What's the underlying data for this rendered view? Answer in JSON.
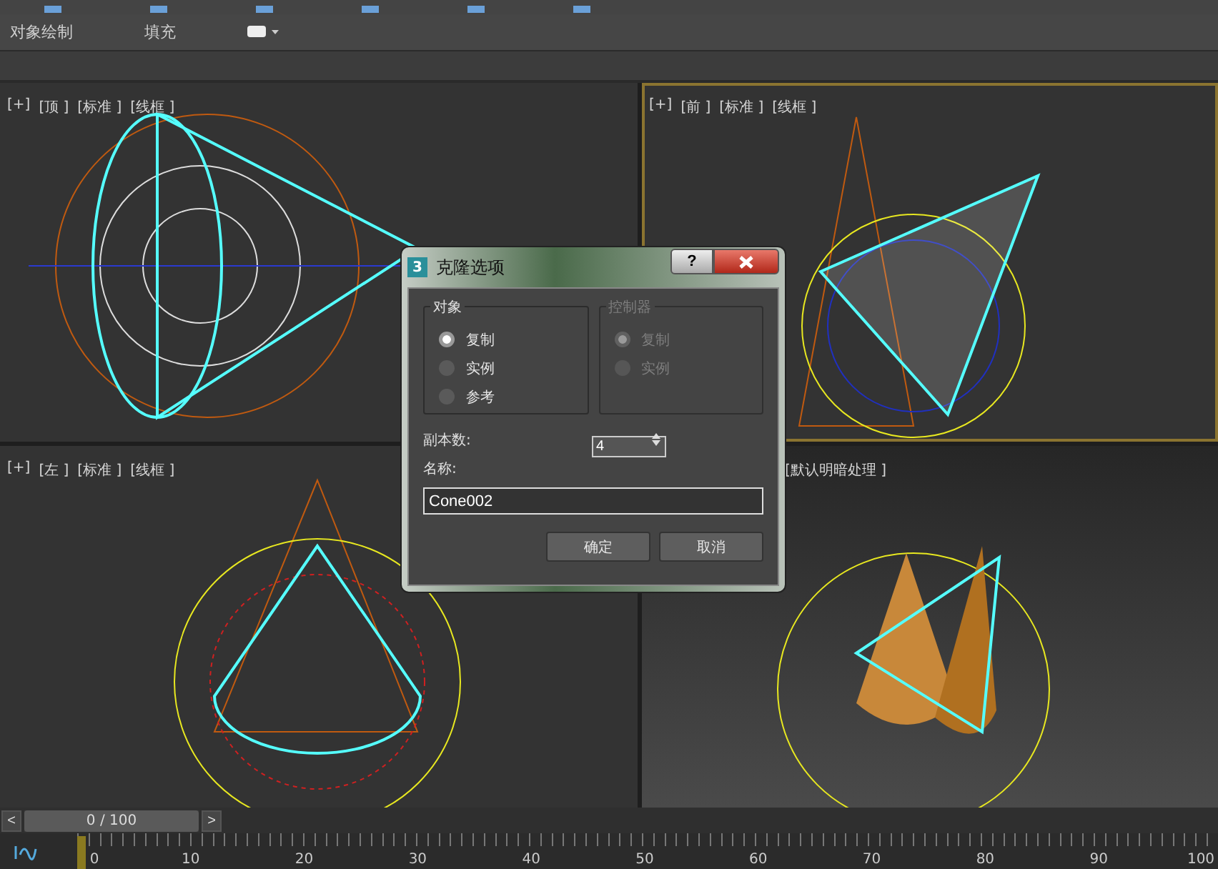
{
  "ribbon": {
    "items": [
      {
        "label": "对象绘制"
      },
      {
        "label": "填充"
      }
    ]
  },
  "viewports": [
    {
      "kind": "top",
      "selected": false,
      "labels": [
        "[+]",
        "[顶 ]",
        "[标准 ]",
        "[线框 ]"
      ]
    },
    {
      "kind": "front",
      "selected": true,
      "labels": [
        "[+]",
        "[前 ]",
        "[标准 ]",
        "[线框 ]"
      ]
    },
    {
      "kind": "left",
      "selected": false,
      "labels": [
        "[+]",
        "[左 ]",
        "[标准 ]",
        "[线框 ]"
      ]
    },
    {
      "kind": "perspective",
      "selected": false,
      "labels": [
        "[默认明暗处理 ]"
      ]
    }
  ],
  "dialog": {
    "icon_text": "3",
    "title": "克隆选项",
    "help": "?",
    "groups": [
      {
        "title": "对象",
        "enabled": true,
        "options": [
          {
            "label": "复制",
            "selected": true
          },
          {
            "label": "实例",
            "selected": false
          },
          {
            "label": "参考",
            "selected": false
          }
        ]
      },
      {
        "title": "控制器",
        "enabled": false,
        "options": [
          {
            "label": "复制",
            "selected": true
          },
          {
            "label": "实例",
            "selected": false
          }
        ]
      }
    ],
    "copies": {
      "label": "副本数:",
      "value": "4"
    },
    "name": {
      "label": "名称:",
      "value": "Cone002"
    },
    "buttons": [
      "确定",
      "取消"
    ]
  },
  "time_slider": {
    "prev": "<",
    "next": ">",
    "frame": "0 / 100",
    "level": 0
  },
  "track_bar": {
    "labels": [
      "0",
      "10",
      "20",
      "30",
      "40",
      "50",
      "60",
      "70",
      "80",
      "90",
      "100"
    ]
  }
}
